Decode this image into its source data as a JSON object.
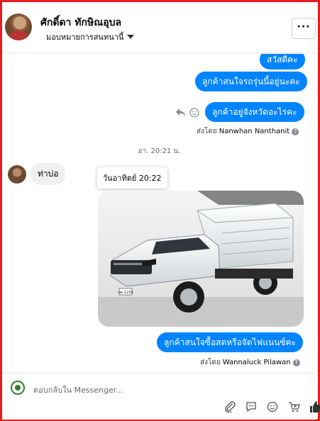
{
  "header": {
    "contact_name": "ศักดิ์ดา ทักษิณอุบล",
    "assign_label": "มอบหมายการสนทนานี้",
    "more_label": "···"
  },
  "messages": {
    "out_1": "สวัสดีคะ",
    "out_2": "ลูกค้าสนใจรถรุ่นนี้อยู่นะคะ",
    "out_3": "ลูกค้าอยู่จังหวัดอะไรคะ",
    "sent_by_1_prefix": "ส่งโดย",
    "sent_by_1_name": "Nanwhan Nanthanit",
    "timestamp": "อา. 20:21 น.",
    "in_1": "ท่าบ่อ",
    "tooltip": "วันอาทิตย์ 20:22",
    "out_4": "ลูกค้าสนใจซื้อสดหรือจัดไฟแนนซ์คะ",
    "sent_by_2_prefix": "ส่งโดย",
    "sent_by_2_name": "Wannaluck Pilawan",
    "help_mark": "?"
  },
  "composer": {
    "placeholder": "ตอบกลับใน Messenger..."
  },
  "photo": {
    "plate_text": "ขค 1234"
  },
  "colors": {
    "accent": "#0084ff",
    "border": "#e41e1e"
  },
  "icons": [
    "reply-icon",
    "emoji-icon",
    "help-icon",
    "attach-icon",
    "saved-reply-icon",
    "emoji-picker-icon",
    "cart-icon",
    "like-icon",
    "more-icon",
    "caret-down-icon"
  ]
}
